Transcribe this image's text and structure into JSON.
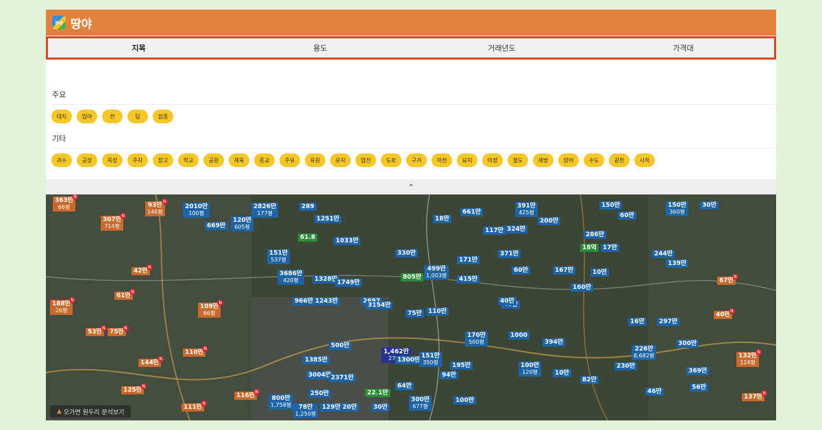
{
  "app": {
    "title": "땅야",
    "logo_text": "땅야"
  },
  "tabs": [
    {
      "label": "지목"
    },
    {
      "label": "용도"
    },
    {
      "label": "거래년도"
    },
    {
      "label": "가격대"
    }
  ],
  "filters": {
    "major_title": "주요",
    "major": [
      "대지",
      "임야",
      "전",
      "답",
      "잡종"
    ],
    "other_title": "기타",
    "other": [
      "과수",
      "공장",
      "목장",
      "주차",
      "창고",
      "학교",
      "공원",
      "체육",
      "종교",
      "주유",
      "유원",
      "유지",
      "염전",
      "도로",
      "구거",
      "하천",
      "묘지",
      "미정",
      "철도",
      "제방",
      "양어",
      "수도",
      "광천",
      "사적"
    ]
  },
  "collapse_icon": "chevron-up-icon",
  "map": {
    "analysis_label": "오가면 원두리 분석보기",
    "markers": [
      {
        "price": "363만",
        "sub": "66평",
        "type": "o"
      },
      {
        "price": "307만",
        "sub": "714평",
        "type": "o"
      },
      {
        "price": "93만",
        "sub": "146평",
        "type": "o"
      },
      {
        "price": "42만",
        "sub": "",
        "type": "o"
      },
      {
        "price": "61만",
        "sub": "",
        "type": "o"
      },
      {
        "price": "188만",
        "sub": "26평",
        "type": "o"
      },
      {
        "price": "109만",
        "sub": "66평",
        "type": "o"
      },
      {
        "price": "53만",
        "sub": "",
        "type": "o"
      },
      {
        "price": "75만",
        "sub": "",
        "type": "o"
      },
      {
        "price": "144만",
        "sub": "",
        "type": "o"
      },
      {
        "price": "110만",
        "sub": "",
        "type": "o"
      },
      {
        "price": "125만",
        "sub": "",
        "type": "o"
      },
      {
        "price": "111만",
        "sub": "",
        "type": "o"
      },
      {
        "price": "116만",
        "sub": "",
        "type": "o"
      },
      {
        "price": "2010만",
        "sub": "100평",
        "type": "b"
      },
      {
        "price": "669만",
        "sub": "",
        "type": "b"
      },
      {
        "price": "120만",
        "sub": "605평",
        "type": "b"
      },
      {
        "price": "2826만",
        "sub": "177평",
        "type": "b"
      },
      {
        "price": "289",
        "sub": "",
        "type": "b"
      },
      {
        "price": "1251만",
        "sub": "",
        "type": "b"
      },
      {
        "price": "61.8",
        "sub": "",
        "type": "g"
      },
      {
        "price": "151만",
        "sub": "537평",
        "type": "b"
      },
      {
        "price": "3686만",
        "sub": "420평",
        "type": "b"
      },
      {
        "price": "1328만",
        "sub": "",
        "type": "b"
      },
      {
        "price": "1033만",
        "sub": "",
        "type": "b"
      },
      {
        "price": "1749만",
        "sub": "",
        "type": "b"
      },
      {
        "price": "966만",
        "sub": "",
        "type": "b"
      },
      {
        "price": "1243만",
        "sub": "",
        "type": "b"
      },
      {
        "price": "2692",
        "sub": "",
        "type": "b"
      },
      {
        "price": "3154만",
        "sub": "",
        "type": "b"
      },
      {
        "price": "330만",
        "sub": "",
        "type": "b"
      },
      {
        "price": "805만",
        "sub": "",
        "type": "g"
      },
      {
        "price": "499만",
        "sub": "1,003평",
        "type": "b"
      },
      {
        "price": "75만",
        "sub": "",
        "type": "b"
      },
      {
        "price": "110만",
        "sub": "",
        "type": "b"
      },
      {
        "price": "1,462만",
        "sub": "274평",
        "type": "nv"
      },
      {
        "price": "1300만",
        "sub": "",
        "type": "b"
      },
      {
        "price": "151만",
        "sub": "350평",
        "type": "b"
      },
      {
        "price": "3004만",
        "sub": "",
        "type": "b"
      },
      {
        "price": "2371만",
        "sub": "",
        "type": "b"
      },
      {
        "price": "500만",
        "sub": "",
        "type": "b"
      },
      {
        "price": "1385만",
        "sub": "",
        "type": "b"
      },
      {
        "price": "250만",
        "sub": "",
        "type": "b"
      },
      {
        "price": "78만",
        "sub": "1,250평",
        "type": "b"
      },
      {
        "price": "129만",
        "sub": "",
        "type": "b"
      },
      {
        "price": "30만",
        "sub": "",
        "type": "b"
      },
      {
        "price": "300만",
        "sub": "677평",
        "type": "b"
      },
      {
        "price": "94만",
        "sub": "",
        "type": "b"
      },
      {
        "price": "100만",
        "sub": "",
        "type": "b"
      },
      {
        "price": "64만",
        "sub": "",
        "type": "b"
      },
      {
        "price": "22.1만",
        "sub": "",
        "type": "g"
      },
      {
        "price": "661만",
        "sub": "",
        "type": "b"
      },
      {
        "price": "117만",
        "sub": "",
        "type": "b"
      },
      {
        "price": "324만",
        "sub": "",
        "type": "b"
      },
      {
        "price": "391만",
        "sub": "425평",
        "type": "b"
      },
      {
        "price": "200만",
        "sub": "",
        "type": "b"
      },
      {
        "price": "171만",
        "sub": "",
        "type": "b"
      },
      {
        "price": "371만",
        "sub": "",
        "type": "b"
      },
      {
        "price": "415만",
        "sub": "",
        "type": "b"
      },
      {
        "price": "60만",
        "sub": "",
        "type": "b"
      },
      {
        "price": "167만",
        "sub": "",
        "type": "b"
      },
      {
        "price": "160만",
        "sub": "",
        "type": "b"
      },
      {
        "price": "170만",
        "sub": "500평",
        "type": "b"
      },
      {
        "price": "1000",
        "sub": "",
        "type": "b"
      },
      {
        "price": "40만",
        "sub": "",
        "type": "b"
      },
      {
        "price": "195만",
        "sub": "",
        "type": "b"
      },
      {
        "price": "100만",
        "sub": "120평",
        "type": "b"
      },
      {
        "price": "10만",
        "sub": "",
        "type": "b"
      },
      {
        "price": "394만",
        "sub": "",
        "type": "b"
      },
      {
        "price": "82만",
        "sub": "",
        "type": "b"
      },
      {
        "price": "230만",
        "sub": "",
        "type": "b"
      },
      {
        "price": "286만",
        "sub": "",
        "type": "b"
      },
      {
        "price": "150만",
        "sub": "",
        "type": "b"
      },
      {
        "price": "60만",
        "sub": "",
        "type": "b"
      },
      {
        "price": "17만",
        "sub": "",
        "type": "b"
      },
      {
        "price": "10만",
        "sub": "",
        "type": "b"
      },
      {
        "price": "244만",
        "sub": "",
        "type": "b"
      },
      {
        "price": "139만",
        "sub": "",
        "type": "b"
      },
      {
        "price": "150만",
        "sub": "360평",
        "type": "b"
      },
      {
        "price": "30만",
        "sub": "",
        "type": "b"
      },
      {
        "price": "16만",
        "sub": "",
        "type": "b"
      },
      {
        "price": "226만",
        "sub": "8,682평",
        "type": "b"
      },
      {
        "price": "297만",
        "sub": "",
        "type": "b"
      },
      {
        "price": "369만",
        "sub": "",
        "type": "b"
      },
      {
        "price": "46만",
        "sub": "",
        "type": "b"
      },
      {
        "price": "56만",
        "sub": "",
        "type": "b"
      },
      {
        "price": "300만",
        "sub": "",
        "type": "b"
      },
      {
        "price": "67만",
        "sub": "",
        "type": "o"
      },
      {
        "price": "40만",
        "sub": "",
        "type": "o"
      },
      {
        "price": "132만",
        "sub": "124평",
        "type": "o"
      },
      {
        "price": "137만",
        "sub": "",
        "type": "o"
      },
      {
        "price": "800만",
        "sub": "1,758평",
        "type": "b"
      },
      {
        "price": "18만",
        "sub": "",
        "type": "b"
      },
      {
        "price": "18억",
        "sub": "",
        "type": "g"
      },
      {
        "price": "40만",
        "sub": "",
        "type": "b"
      },
      {
        "price": "20만",
        "sub": "",
        "type": "b"
      }
    ]
  }
}
